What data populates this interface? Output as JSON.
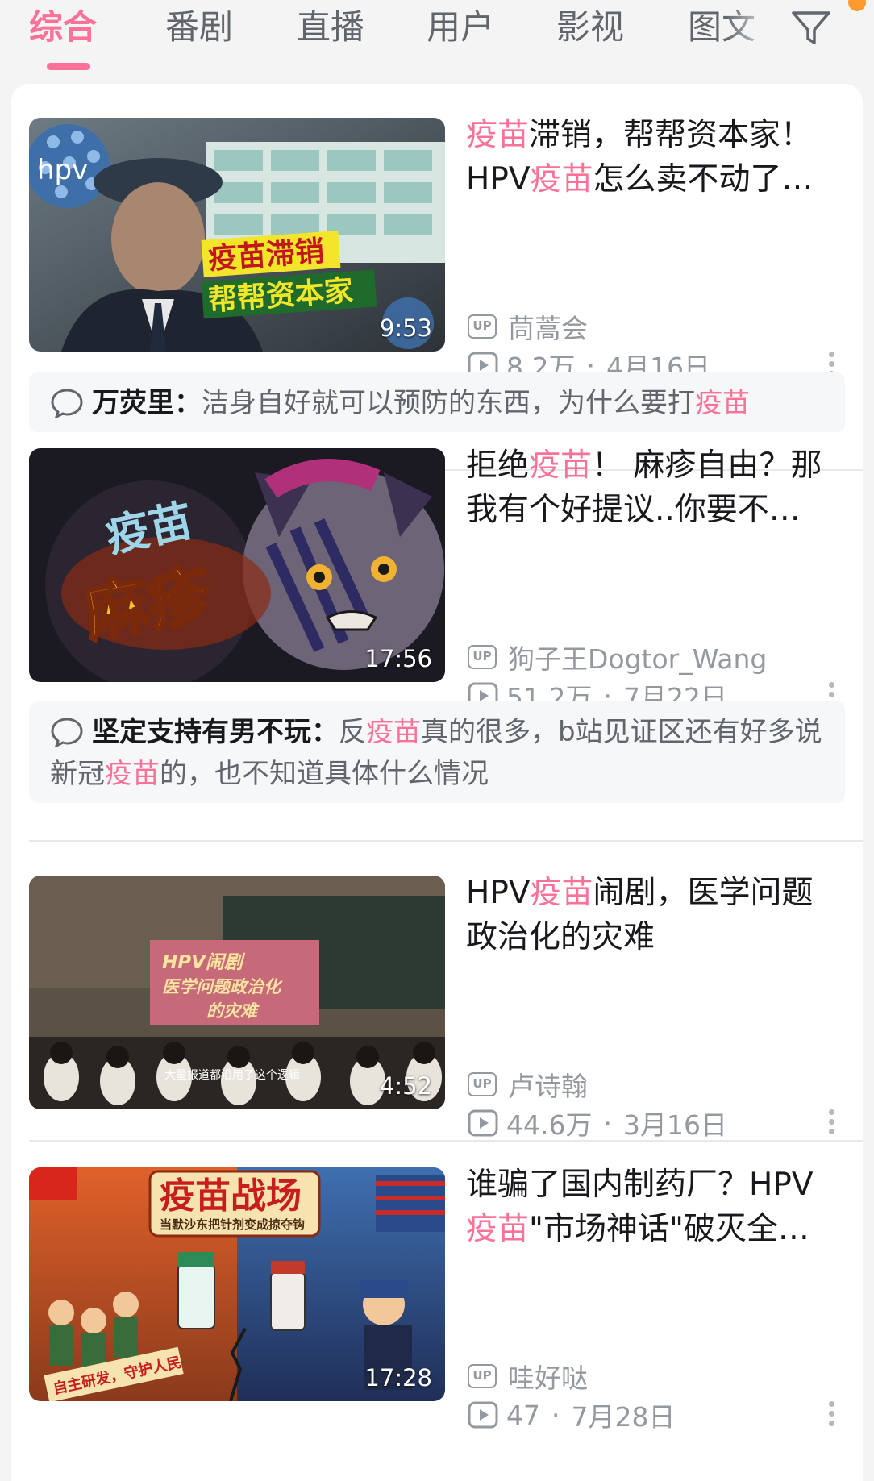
{
  "tabs": [
    {
      "label": "综合",
      "active": true
    },
    {
      "label": "番剧",
      "active": false
    },
    {
      "label": "直播",
      "active": false
    },
    {
      "label": "用户",
      "active": false
    },
    {
      "label": "影视",
      "active": false
    },
    {
      "label": "图文",
      "active": false
    }
  ],
  "filter_icon": "filter-funnel-icon",
  "accent_color": "#fb7299",
  "videos": [
    {
      "title_pre": "",
      "title_hl": "疫苗",
      "title_mid": "滞销，帮帮资本家！",
      "title_line2_pre": "HPV",
      "title_line2_hl": "疫苗",
      "title_line2_post": "怎么卖不动了…",
      "thumb_text_1": "hpv",
      "thumb_text_2": "疫苗滞销",
      "thumb_text_3": "帮帮资本家",
      "duration": "9:53",
      "up_badge": "UP",
      "uploader": "茼蒿会",
      "views": "8.2万",
      "date": "4月16日",
      "comment": {
        "author": "万荧里：",
        "text_pre": "洁身自好就可以预防的东西，为什么要打",
        "text_hl": "疫苗",
        "text_post": ""
      }
    },
    {
      "title_pre": "拒绝",
      "title_hl": "疫苗",
      "title_mid": "！ 麻疹自由？那",
      "title_line2_pre": "我有个好提议..你要不…",
      "title_line2_hl": "",
      "title_line2_post": "",
      "thumb_text_1": "疫苗",
      "thumb_text_2": "麻疹",
      "thumb_text_3": "",
      "duration": "17:56",
      "up_badge": "UP",
      "uploader": "狗子王Dogtor_Wang",
      "views": "51.2万",
      "date": "7月22日",
      "comment": {
        "author": "坚定支持有男不玩：",
        "text_pre": "反",
        "text_hl": "疫苗",
        "text_post": "真的很多，b站见证区还有好多说新冠",
        "text_hl2": "疫苗",
        "text_post2": "的，也不知道具体什么情况"
      }
    },
    {
      "title_pre": "HPV",
      "title_hl": "疫苗",
      "title_mid": "闹剧，医学问题",
      "title_line2_pre": "政治化的灾难",
      "title_line2_hl": "",
      "title_line2_post": "",
      "thumb_text_1": "HPV闹剧",
      "thumb_text_2": "医学问题政治化",
      "thumb_text_3": "的灾难",
      "thumb_caption": "大量报道都沿用了这个逻辑",
      "duration": "4:52",
      "up_badge": "UP",
      "uploader": "卢诗翰",
      "views": "44.6万",
      "date": "3月16日"
    },
    {
      "title_pre": "谁骗了国内制药厂？HPV",
      "title_hl": "",
      "title_mid": "",
      "title_line2_pre": "",
      "title_line2_hl": "疫苗",
      "title_line2_post": "\"市场神话\"破灭全…",
      "thumb_text_1": "疫苗战场",
      "thumb_text_2": "当默沙东把针剂变成掠夺钩",
      "thumb_text_3": "自主研发，守护人民",
      "duration": "17:28",
      "up_badge": "UP",
      "uploader": "哇好哒",
      "views": "47",
      "date": "7月28日"
    }
  ]
}
